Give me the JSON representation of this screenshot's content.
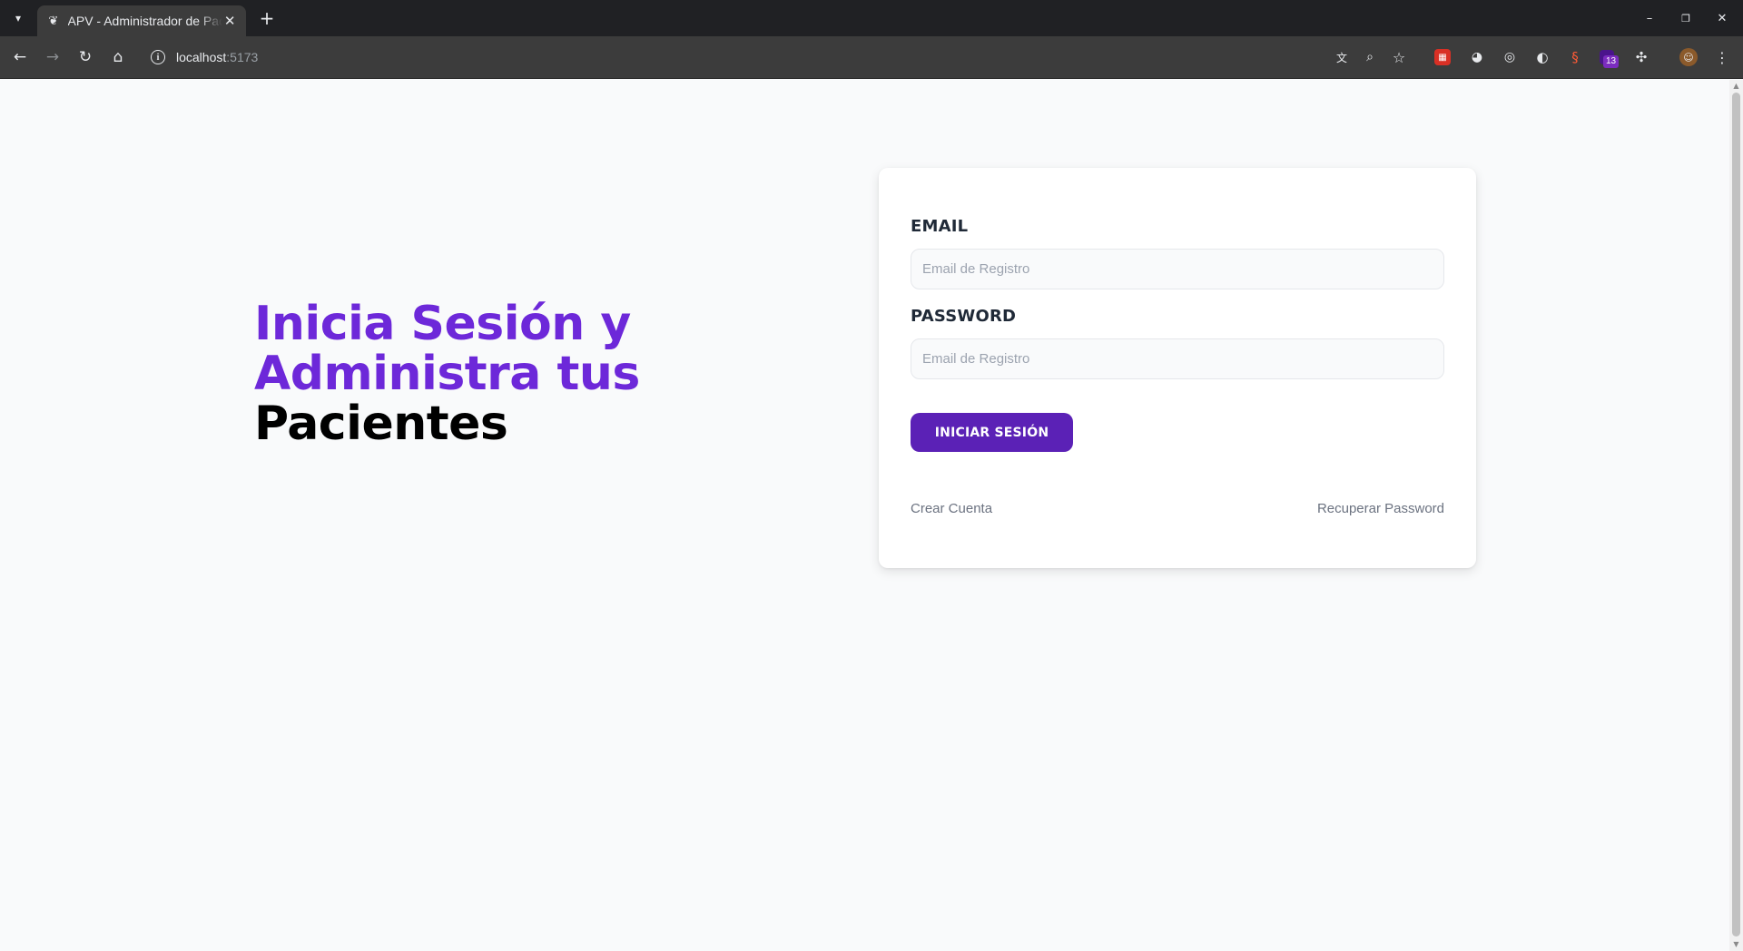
{
  "browser": {
    "tab_title": "APV - Administrador de Pacientes",
    "url_host": "localhost",
    "url_port": ":5173",
    "extension_badge": "13",
    "accent_colors": {
      "tabbar": "#202124",
      "toolbar": "#3c3c3c"
    }
  },
  "page": {
    "title_purple": "Inicia Sesión y Administra tus ",
    "title_dark": "Pacientes",
    "colors": {
      "primary": "#6d28d9",
      "button": "#5b21b6",
      "background": "#f9fafb"
    }
  },
  "form": {
    "email_label": "EMAIL",
    "email_placeholder": "Email de Registro",
    "password_label": "PASSWORD",
    "password_placeholder": "Email de Registro",
    "submit_label": "INICIAR SESIÓN",
    "create_account": "Crear Cuenta",
    "recover_password": "Recuperar Password"
  }
}
